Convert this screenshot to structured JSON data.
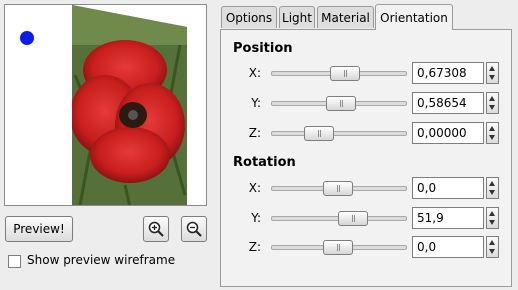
{
  "preview_pane": {
    "image": "red-poppy-flower-image",
    "light_marker": "light-position-dot"
  },
  "buttons": {
    "preview_label": "Preview!",
    "zoom_in_icon": "zoom-in-icon",
    "zoom_out_icon": "zoom-out-icon"
  },
  "wireframe": {
    "label": "Show preview wireframe",
    "checked": false
  },
  "tabs": [
    {
      "label": "Options",
      "active": false
    },
    {
      "label": "Light",
      "active": false
    },
    {
      "label": "Material",
      "active": false
    },
    {
      "label": "Orientation",
      "active": true
    }
  ],
  "position": {
    "title": "Position",
    "x": {
      "label": "X:",
      "value": "0,67308",
      "slider": 0.67308
    },
    "y": {
      "label": "Y:",
      "value": "0,58654",
      "slider": 0.58654
    },
    "z": {
      "label": "Z:",
      "value": "0,00000",
      "slider": 0.0
    }
  },
  "rotation": {
    "title": "Rotation",
    "x": {
      "label": "X:",
      "value": "0,0",
      "slider": 0.0
    },
    "y": {
      "label": "Y:",
      "value": "51,9",
      "slider": 51.9
    },
    "z": {
      "label": "Z:",
      "value": "0,0",
      "slider": 0.0
    }
  },
  "colors": {
    "light_dot": "#0a1ee8",
    "poppy_red": "#c81e1e",
    "foliage_green": "#4a6a2a"
  }
}
